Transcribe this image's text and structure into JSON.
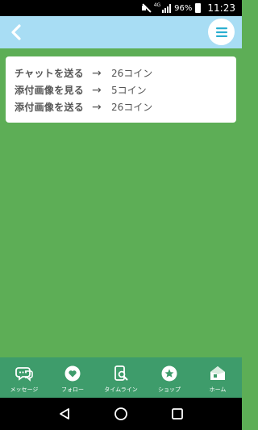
{
  "status_bar": {
    "battery": "96%",
    "time": "11:23",
    "network": "4G",
    "icons": [
      "mute-icon",
      "signal-icon",
      "battery-icon"
    ]
  },
  "header": {
    "back_icon": "chevron-left-icon",
    "menu_icon": "menu-icon",
    "accent": "#a8ddf4",
    "menu_color": "#2bafd0"
  },
  "info": {
    "rows": [
      {
        "label": "チャットを送る",
        "arrow": "→",
        "value": "26コイン"
      },
      {
        "label": "添付画像を見る",
        "arrow": "→",
        "value": "5コイン"
      },
      {
        "label": "添付画像を送る",
        "arrow": "→",
        "value": "26コイン"
      }
    ]
  },
  "bottom_nav": {
    "background": "#3e9c6b",
    "items": [
      {
        "icon": "chat-icon",
        "label": "メッセージ"
      },
      {
        "icon": "heart-icon",
        "label": "フォロー"
      },
      {
        "icon": "timeline-search-icon",
        "label": "タイムライン"
      },
      {
        "icon": "star-icon",
        "label": "ショップ"
      },
      {
        "icon": "home-icon",
        "label": "ホーム"
      }
    ]
  },
  "system_nav": {
    "icons": [
      "back-triangle-icon",
      "home-circle-icon",
      "recents-square-icon"
    ]
  },
  "page_background": "#5dae56"
}
